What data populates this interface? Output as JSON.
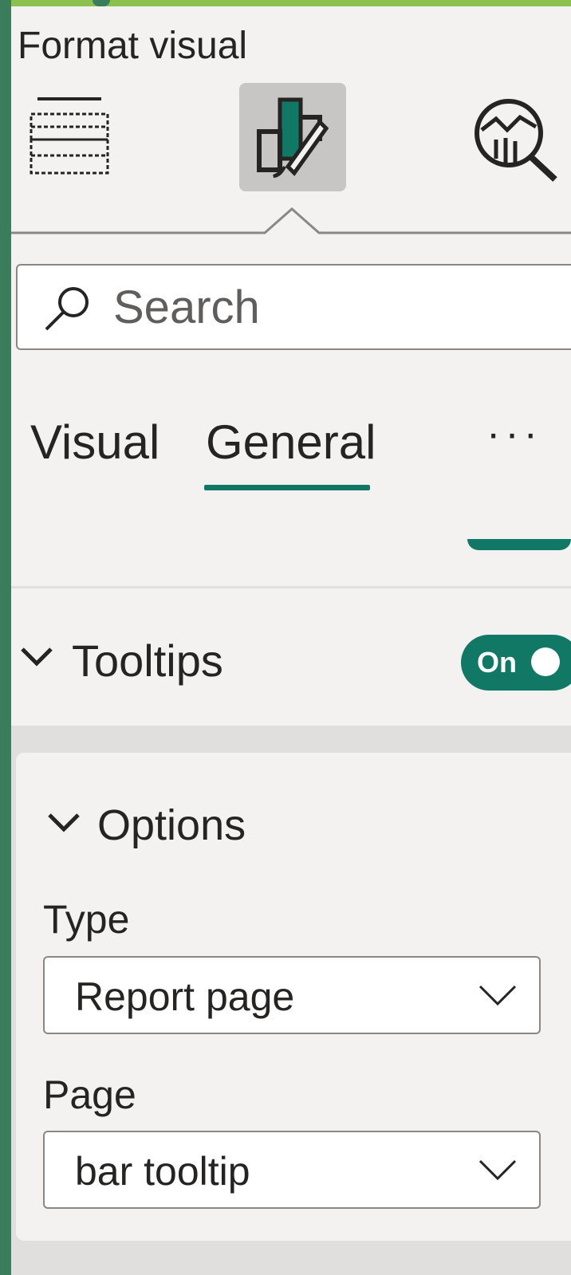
{
  "panel": {
    "title": "Format visual",
    "icons": {
      "build": "build-visual-icon",
      "format": "format-visual-icon",
      "analytics": "analytics-icon"
    }
  },
  "search": {
    "placeholder": "Search",
    "value": ""
  },
  "tabs": [
    {
      "label": "Visual",
      "active": false
    },
    {
      "label": "General",
      "active": true
    }
  ],
  "tabs_more": "···",
  "sections": {
    "tooltips": {
      "label": "Tooltips",
      "expanded": true,
      "toggle": {
        "label": "On",
        "state": true
      }
    },
    "options": {
      "label": "Options",
      "expanded": true,
      "fields": [
        {
          "label": "Type",
          "value": "Report page"
        },
        {
          "label": "Page",
          "value": "bar tooltip"
        }
      ]
    }
  },
  "colors": {
    "accent": "#117865",
    "left_bar": "#3a7d5c",
    "top_bar": "#8cc04f",
    "panel_bg": "#f3f2f1",
    "selected_icon_bg": "#c8c6c4"
  }
}
